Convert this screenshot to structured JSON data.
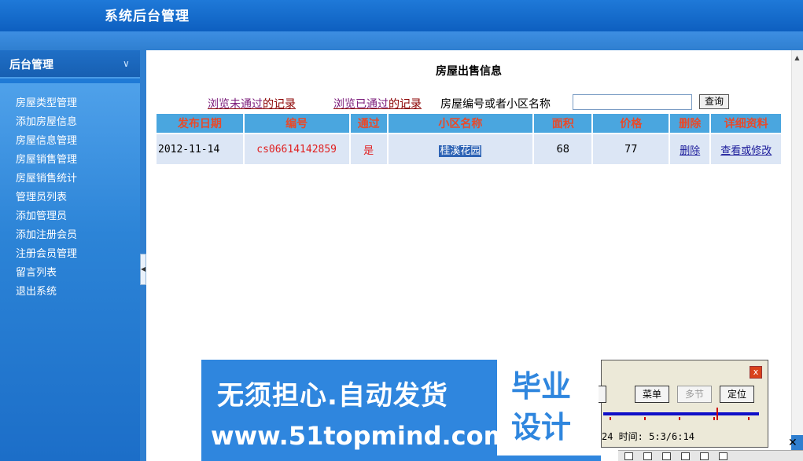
{
  "header": {
    "title": "系统后台管理"
  },
  "sidebar": {
    "title": "后台管理",
    "items": [
      {
        "label": "房屋类型管理"
      },
      {
        "label": "添加房屋信息"
      },
      {
        "label": "房屋信息管理"
      },
      {
        "label": "房屋销售管理"
      },
      {
        "label": "房屋销售统计"
      },
      {
        "label": "管理员列表"
      },
      {
        "label": "添加管理员"
      },
      {
        "label": "添加注册会员"
      },
      {
        "label": "注册会员管理"
      },
      {
        "label": "留言列表"
      },
      {
        "label": "退出系统"
      }
    ]
  },
  "main": {
    "title": "房屋出售信息",
    "filter": {
      "unapproved_pre": "浏览未通过",
      "unapproved_post": "的记录",
      "approved_pre": "浏览已通过",
      "approved_post": "的记录",
      "search_label": "房屋编号或者小区名称",
      "search_value": "",
      "search_button": "查询"
    },
    "table": {
      "headers": [
        "发布日期",
        "编号",
        "通过",
        "小区名称",
        "面积",
        "价格",
        "删除",
        "详细资料"
      ],
      "rows": [
        {
          "date": "2012-11-14",
          "code": "cs06614142859",
          "passed": "是",
          "community": "桂溪花园",
          "area": "68",
          "price": "77",
          "delete": "删除",
          "detail": "查看或修改"
        }
      ]
    }
  },
  "banner": {
    "slogan": "无须担心.自动发货",
    "url": "www.51topmind.com",
    "box_text": "毕业设计"
  },
  "player": {
    "close": "x",
    "buttons": [
      "菜单",
      "多节",
      "定位"
    ],
    "time_text": "24 时间: 5:3/6:14"
  }
}
